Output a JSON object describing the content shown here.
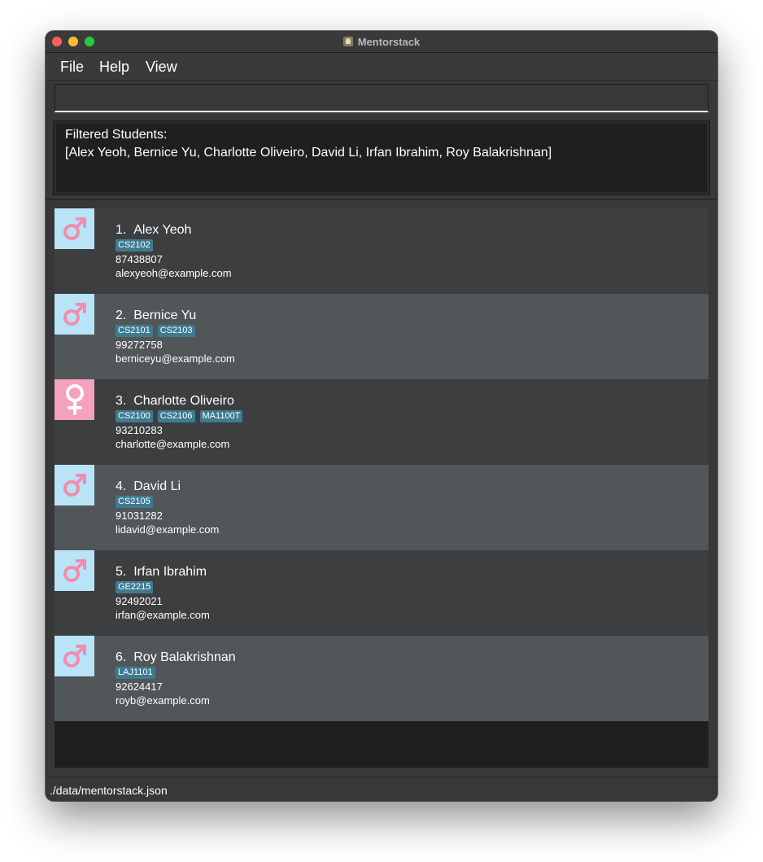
{
  "window": {
    "title": "Mentorstack"
  },
  "menu": {
    "file": "File",
    "help": "Help",
    "view": "View"
  },
  "command": {
    "value": "",
    "placeholder": ""
  },
  "result": {
    "line1": "Filtered Students:",
    "line2": "[Alex Yeoh, Bernice Yu, Charlotte Oliveiro, David Li, Irfan Ibrahim, Roy Balakrishnan]"
  },
  "students": [
    {
      "index": "1.",
      "name": "Alex Yeoh",
      "gender": "male",
      "tags": [
        "CS2102"
      ],
      "phone": "87438807",
      "email": "alexyeoh@example.com"
    },
    {
      "index": "2.",
      "name": "Bernice Yu",
      "gender": "male",
      "tags": [
        "CS2101",
        "CS2103"
      ],
      "phone": "99272758",
      "email": "berniceyu@example.com"
    },
    {
      "index": "3.",
      "name": "Charlotte Oliveiro",
      "gender": "female",
      "tags": [
        "CS2100",
        "CS2106",
        "MA1100T"
      ],
      "phone": "93210283",
      "email": "charlotte@example.com"
    },
    {
      "index": "4.",
      "name": "David Li",
      "gender": "male",
      "tags": [
        "CS2105"
      ],
      "phone": "91031282",
      "email": "lidavid@example.com"
    },
    {
      "index": "5.",
      "name": "Irfan Ibrahim",
      "gender": "male",
      "tags": [
        "GE2215"
      ],
      "phone": "92492021",
      "email": "irfan@example.com"
    },
    {
      "index": "6.",
      "name": "Roy Balakrishnan",
      "gender": "male",
      "tags": [
        "LAJ1101"
      ],
      "phone": "92624417",
      "email": "royb@example.com"
    }
  ],
  "status": {
    "path": "./data/mentorstack.json"
  },
  "colors": {
    "male_avatar_bg": "#b9e3f7",
    "female_avatar_bg": "#f4a1bb",
    "gender_symbol": "#f18db0",
    "female_symbol": "#ffffff",
    "tag_bg": "#3e7b91"
  }
}
